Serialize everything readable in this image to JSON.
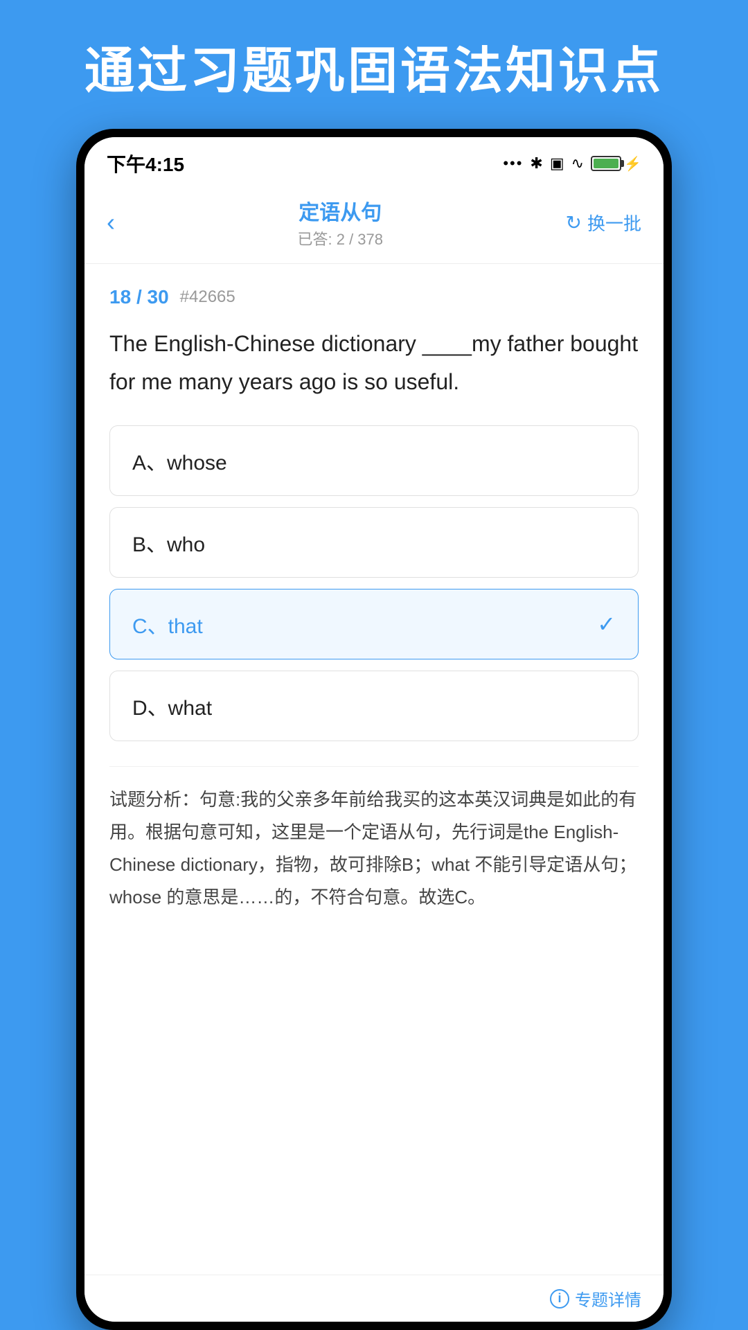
{
  "page": {
    "title": "通过习题巩固语法知识点",
    "background_color": "#3d9af0"
  },
  "status_bar": {
    "time": "下午4:15",
    "battery_percent": 100
  },
  "nav": {
    "back_icon": "‹",
    "title": "定语从句",
    "subtitle": "已答: 2 / 378",
    "action_label": "换一批"
  },
  "question": {
    "current": "18",
    "total": "30",
    "id": "#42665",
    "text": "The English-Chinese dictionary ____my father bought for me many years ago is so useful.",
    "options": [
      {
        "key": "A",
        "separator": "、",
        "value": "whose",
        "selected": false
      },
      {
        "key": "B",
        "separator": "、",
        "value": "who",
        "selected": false
      },
      {
        "key": "C",
        "separator": "、",
        "value": "that",
        "selected": true
      },
      {
        "key": "D",
        "separator": "、",
        "value": "what",
        "selected": false
      }
    ],
    "analysis_label": "试题分析：",
    "analysis_text": "句意:我的父亲多年前给我买的这本英汉词典是如此的有用。根据句意可知，这里是一个定语从句，先行词是the English-Chinese dictionary，指物，故可排除B；what 不能引导定语从句；whose 的意思是……的，不符合句意。故选C。"
  },
  "footer": {
    "topic_detail_label": "专题详情"
  }
}
